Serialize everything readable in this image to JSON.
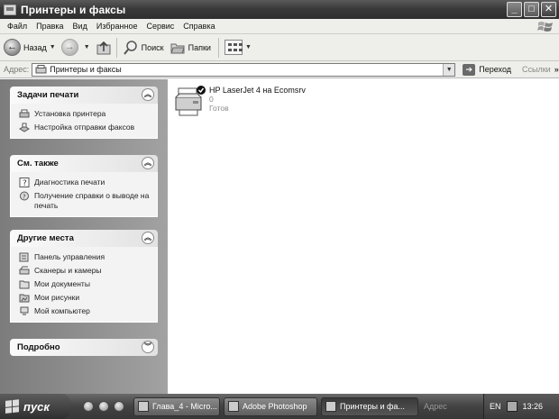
{
  "window": {
    "title": "Принтеры и факсы"
  },
  "menu": [
    "Файл",
    "Правка",
    "Вид",
    "Избранное",
    "Сервис",
    "Справка"
  ],
  "toolbar": {
    "back": "Назад",
    "search": "Поиск",
    "folders": "Папки"
  },
  "address": {
    "label": "Адрес:",
    "value": "Принтеры и факсы",
    "go": "Переход",
    "links": "Ссылки"
  },
  "sidebar": {
    "print_tasks": {
      "title": "Задачи печати",
      "items": [
        "Установка принтера",
        "Настройка отправки факсов"
      ]
    },
    "see_also": {
      "title": "См. также",
      "items": [
        "Диагностика печати",
        "Получение справки о выводе на печать"
      ]
    },
    "other_places": {
      "title": "Другие места",
      "items": [
        "Панель управления",
        "Сканеры и камеры",
        "Мои документы",
        "Мои рисунки",
        "Мой компьютер"
      ]
    },
    "details": {
      "title": "Подробно"
    }
  },
  "printer": {
    "name": "HP LaserJet 4 на Ecomsrv",
    "queue": "0",
    "status": "Готов"
  },
  "taskbar": {
    "start": "пуск",
    "buttons": [
      "Глава_4 - Micro...",
      "Adobe Photoshop",
      "Принтеры и фа..."
    ],
    "address_label": "Адрес",
    "lang": "EN",
    "clock": "13:26"
  }
}
